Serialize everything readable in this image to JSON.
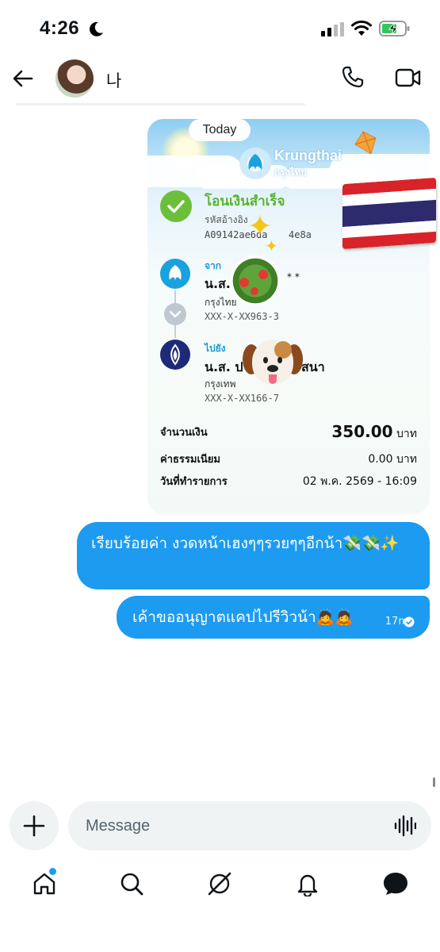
{
  "status_bar": {
    "time": "4:26"
  },
  "header": {
    "contact_name": "나"
  },
  "receipt": {
    "date_pill": "Today",
    "bank_name": "Krungthai",
    "bank_name_th": "กรุงไทย",
    "status_title": "โอนเงินสำเร็จ",
    "ref_label": "รหัสอ้างอิง",
    "ref_value": "A09142ae6da",
    "ref_value_tail": "4e8a",
    "from_label": "จาก",
    "from_name": "น.ส.",
    "from_name_tail": "* *",
    "from_bank": "กรุงไทย",
    "from_account": "XXX-X-XX963-3",
    "to_label": "ไปยัง",
    "to_name": "น.ส. ป",
    "to_name_tail": "สนา",
    "to_bank": "กรุงเทพ",
    "to_account": "XXX-X-XX166-7",
    "amount_label": "จำนวนเงิน",
    "amount_value": "350.00",
    "amount_unit": "บาท",
    "fee_label": "ค่าธรรมเนียม",
    "fee_value": "0.00 บาท",
    "date_label": "วันที่ทำรายการ",
    "date_value": "02 พ.ค. 2569 - 16:09"
  },
  "messages": [
    {
      "text": "เรียบร้อยค่า งวดหน้าเฮงๆๆรวยๆๆอีกน้า💸💸✨"
    },
    {
      "text": "เค้าขออนุญาตแคปไปรีวิวน้า🙇🙇",
      "time": "17m"
    }
  ],
  "composer": {
    "placeholder": "Message"
  },
  "colors": {
    "accent": "#1d9bf0",
    "success": "#5ab330",
    "krungthai": "#1aa1e0"
  },
  "icons": [
    "back-arrow-icon",
    "phone-icon",
    "video-icon",
    "plus-icon",
    "voice-icon",
    "home-icon",
    "search-icon",
    "grok-icon",
    "bell-icon",
    "messages-icon"
  ]
}
